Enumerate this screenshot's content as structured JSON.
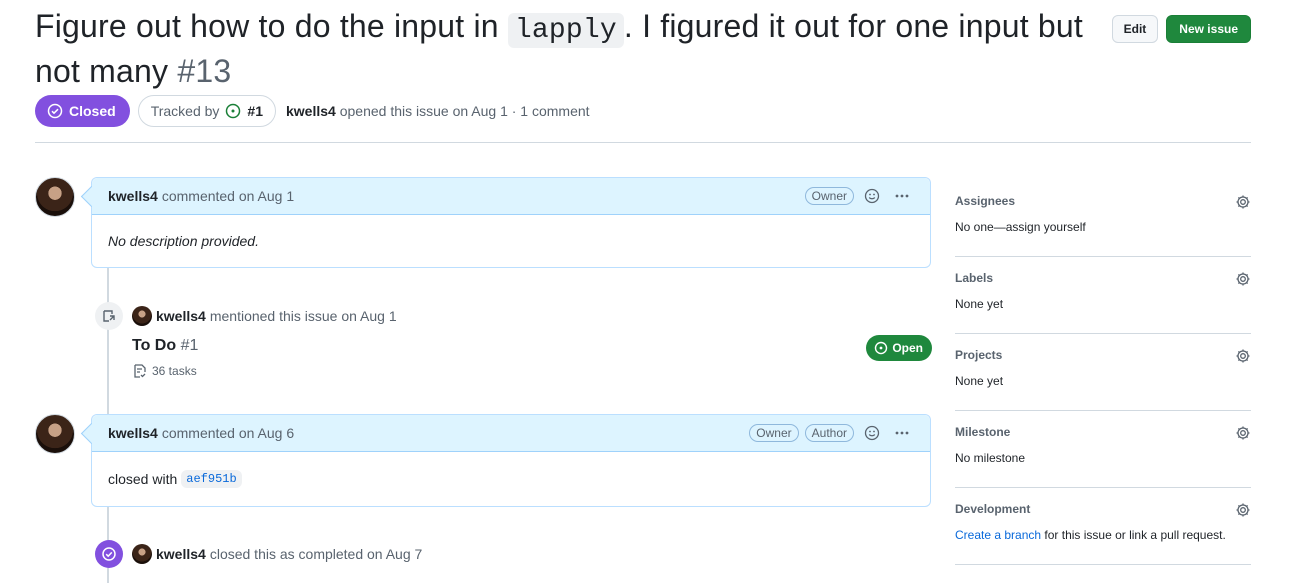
{
  "issue": {
    "title_before": "Figure out how to do the input in ",
    "title_code": "lapply",
    "title_after": ". I figured it out for one input but not many",
    "number": "#13",
    "state": "Closed",
    "tracked_label": "Tracked by",
    "tracked_ref": "#1",
    "author": "kwells4",
    "meta_suffix": "opened this issue on Aug 1 · 1 comment"
  },
  "header": {
    "edit_label": "Edit",
    "new_issue_label": "New issue"
  },
  "timeline": {
    "comment1": {
      "author": "kwells4",
      "action": "commented on Aug 1",
      "role": "Owner",
      "body": "No description provided."
    },
    "mention": {
      "author": "kwells4",
      "action": "mentioned this issue on Aug 1",
      "ref_title": "To Do",
      "ref_number": "#1",
      "tasks": "36 tasks",
      "state": "Open"
    },
    "comment2": {
      "author": "kwells4",
      "action": "commented on Aug 6",
      "role1": "Owner",
      "role2": "Author",
      "body_prefix": "closed with",
      "sha": "aef951b"
    },
    "closed_event": {
      "author": "kwells4",
      "action": "closed this as completed on Aug 7"
    }
  },
  "sidebar": {
    "assignees": {
      "title": "Assignees",
      "value": "No one—assign yourself"
    },
    "labels": {
      "title": "Labels",
      "value": "None yet"
    },
    "projects": {
      "title": "Projects",
      "value": "None yet"
    },
    "milestone": {
      "title": "Milestone",
      "value": "No milestone"
    },
    "development": {
      "title": "Development",
      "link": "Create a branch",
      "value_suffix": " for this issue or link a pull request."
    }
  },
  "colors": {
    "closed": "#8250df",
    "open": "#1f883d",
    "link": "#0969da"
  }
}
